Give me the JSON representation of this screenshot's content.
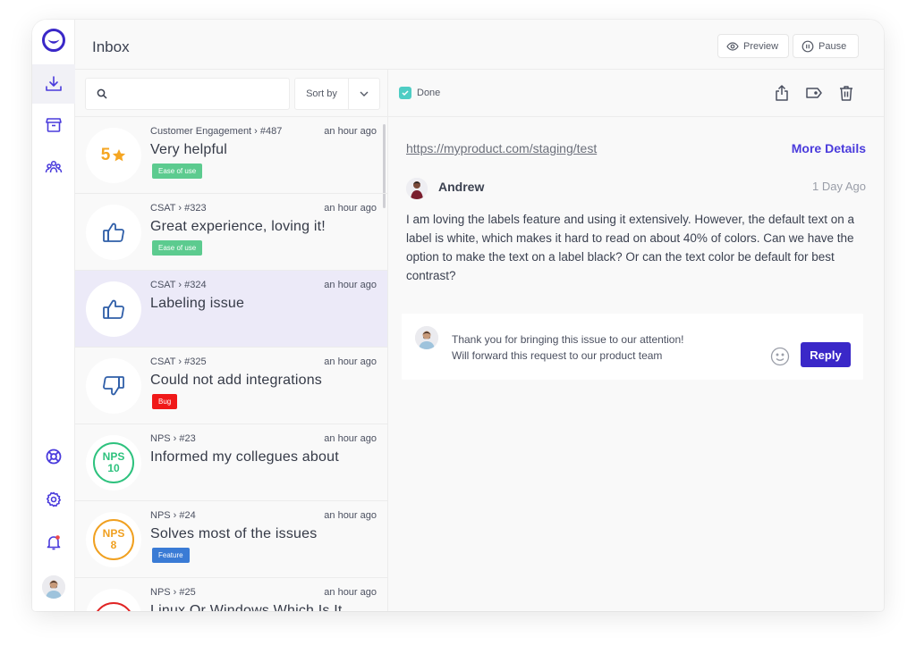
{
  "header": {
    "title": "Inbox",
    "preview_label": "Preview",
    "pause_label": "Pause"
  },
  "sidebar": {
    "items": [
      {
        "name": "inbox",
        "icon": "download-tray-icon",
        "active": true
      },
      {
        "name": "archive",
        "icon": "archive-box-icon",
        "active": false
      },
      {
        "name": "team",
        "icon": "people-group-icon",
        "active": false
      },
      {
        "name": "support",
        "icon": "lifebuoy-icon",
        "active": false
      },
      {
        "name": "settings",
        "icon": "gear-icon",
        "active": false
      },
      {
        "name": "notifications",
        "icon": "bell-icon",
        "active": false,
        "has_badge": true
      }
    ]
  },
  "list": {
    "search_placeholder": "",
    "sort_label": "Sort by",
    "items": [
      {
        "meta": "Customer Engagement › #487",
        "time": "an hour ago",
        "title": "Very helpful",
        "score_type": "star",
        "score": "5",
        "tag": "Ease of use",
        "tag_color": "#5ccb8f"
      },
      {
        "meta": "CSAT › #323",
        "time": "an hour ago",
        "title": "Great experience, loving it!",
        "score_type": "thumbs-up",
        "tag": "Ease of use",
        "tag_color": "#5ccb8f"
      },
      {
        "meta": "CSAT › #324",
        "time": "an hour ago",
        "title": "Labeling issue",
        "score_type": "thumbs-up",
        "tag": null,
        "selected": true
      },
      {
        "meta": "CSAT › #325",
        "time": "an hour ago",
        "title": "Could not add integrations",
        "score_type": "thumbs-down",
        "tag": "Bug",
        "tag_color": "#f01818"
      },
      {
        "meta": "NPS › #23",
        "time": "an hour ago",
        "title": "Informed my collegues about",
        "score_type": "nps",
        "nps_label": "NPS",
        "score": "10",
        "ring_color": "#2ec27e",
        "tag": null
      },
      {
        "meta": "NPS › #24",
        "time": "an hour ago",
        "title": "Solves most of the issues",
        "score_type": "nps",
        "nps_label": "NPS",
        "score": "8",
        "ring_color": "#f0a020",
        "tag": "Feature",
        "tag_color": "#3a7bd5"
      },
      {
        "meta": "NPS › #25",
        "time": "an hour ago",
        "title": "Linux Or Windows Which Is It",
        "score_type": "nps",
        "nps_label": "NPS",
        "score": "",
        "ring_color": "#e02424",
        "tag": null
      }
    ]
  },
  "detail": {
    "done_label": "Done",
    "done_checked": true,
    "url": "https://myproduct.com/staging/test",
    "more_details_label": "More Details",
    "author": "Andrew",
    "ago": "1 Day Ago",
    "message": "I am loving the labels feature and using it extensively.  However, the default text on a label is white, which makes it hard to read on about 40% of colors.  Can we have the option to make the text on a label black? Or can the text color be default for best contrast?",
    "reply_text": "Thank you for bringing this issue to our attention!\nWill forward this request to our product team",
    "reply_label": "Reply"
  },
  "colors": {
    "accent": "#3a28c8",
    "link_accent": "#4a3bdc",
    "done_check": "#4ecdc4",
    "selected_row": "#eceaf8"
  }
}
